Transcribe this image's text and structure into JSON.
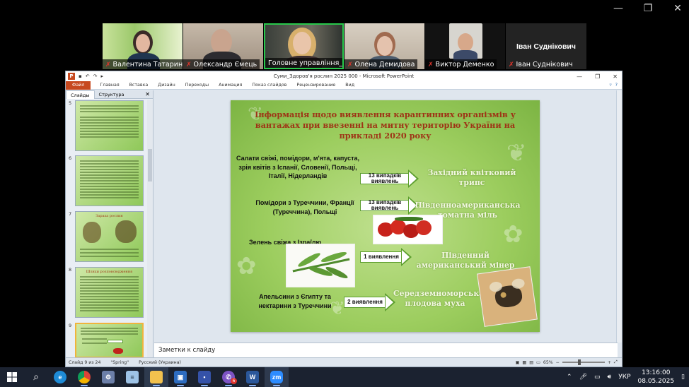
{
  "zoom": {
    "participants": [
      {
        "name": "Валентина Татаринова",
        "muted": true
      },
      {
        "name": "Олександр Ємець",
        "muted": true
      },
      {
        "name": "Головне управління_Де...",
        "muted": false,
        "active": true
      },
      {
        "name": "Олена Демидова",
        "muted": true
      },
      {
        "name": "Виктор Деменко",
        "muted": true
      },
      {
        "name": "Іван Судніковчи",
        "muted": true,
        "display_name": "Іван Суднікович",
        "label": "Іван Суднікович"
      }
    ],
    "window_controls": {
      "minimize": "—",
      "restore": "❐",
      "close": "✕"
    }
  },
  "ppt": {
    "window_title": "Суми_Здоров'я рослин 2025 000  -  Microsoft PowerPoint",
    "ribbon_tabs": [
      "Файл",
      "Главная",
      "Вставка",
      "Дизайн",
      "Переходы",
      "Анимация",
      "Показ слайдов",
      "Рецензирование",
      "Вид"
    ],
    "pane_tabs": {
      "slides": "Слайды",
      "outline": "Структура"
    },
    "thumbnails": [
      {
        "num": "5",
        "title": ""
      },
      {
        "num": "6",
        "title": ""
      },
      {
        "num": "7",
        "title": "Зараза рослин"
      },
      {
        "num": "8",
        "title": "Шляхи розповсюдження"
      },
      {
        "num": "9",
        "title": "",
        "selected": true
      }
    ],
    "notes_placeholder": "Заметки к слайду",
    "status": {
      "slide_counter": "Слайд 9 из 24",
      "theme": "\"Spring\"",
      "language": "Русский (Украина)",
      "zoom": "65%"
    }
  },
  "slide": {
    "title": "Інформація щодо виявлення карантинних організмів у вантажах при ввезенні на митну територію України на прикладі 2020 року",
    "rows": [
      {
        "source": "Салати свіжі,  помідори, м'ята, капуста, зрія квітів  з Іспанії, Словенії, Польщі, Італії, Нідерландів",
        "count": "13 випадків виявлень",
        "organism": "Західний квітковий трипс"
      },
      {
        "source": "Помідори з Туреччини, Франції (Туреччина), Польщі",
        "count": "13 випадків виявлень",
        "organism": "Південноамериканська томатна міль"
      },
      {
        "source": "Зелень свіжа з Ізраїлю",
        "count": "1 виявлення",
        "organism": "Південний американський мінер"
      },
      {
        "source": "Апельсини з Єгипту та нектарини з Туреччини",
        "count": "2 виявлення",
        "organism": "Середземноморська плодова муха"
      }
    ]
  },
  "taskbar": {
    "lang": "УКР",
    "time": "13:16:00",
    "date": "08.05.2025",
    "viber_badge": "6",
    "zoom_label": "zm",
    "word_label": "W"
  }
}
